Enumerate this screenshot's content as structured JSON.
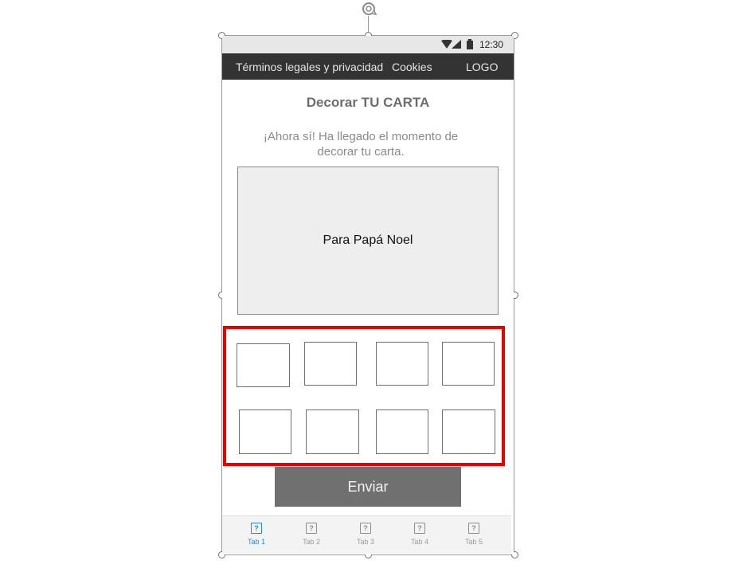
{
  "status_bar": {
    "time": "12:30"
  },
  "nav": {
    "legal": "Términos legales y privacidad",
    "cookies": "Cookies",
    "logo": "LOGO"
  },
  "page": {
    "title": "Decorar TU CARTA",
    "intro": "¡Ahora sí! Ha llegado el momento de decorar tu carta."
  },
  "card": {
    "text": "Para Papá Noel"
  },
  "decorations": {
    "count": 8
  },
  "send_button": {
    "label": "Enviar"
  },
  "tabs": [
    {
      "label": "Tab 1",
      "icon": "?",
      "active": true
    },
    {
      "label": "Tab 2",
      "icon": "?"
    },
    {
      "label": "Tab 3",
      "icon": "?"
    },
    {
      "label": "Tab 4",
      "icon": "?"
    },
    {
      "label": "Tab 5",
      "icon": "?"
    }
  ],
  "colors": {
    "nav_bg": "#333333",
    "highlight": "#e60000",
    "active_tab": "#2f86d4",
    "button_bg": "#707070"
  }
}
